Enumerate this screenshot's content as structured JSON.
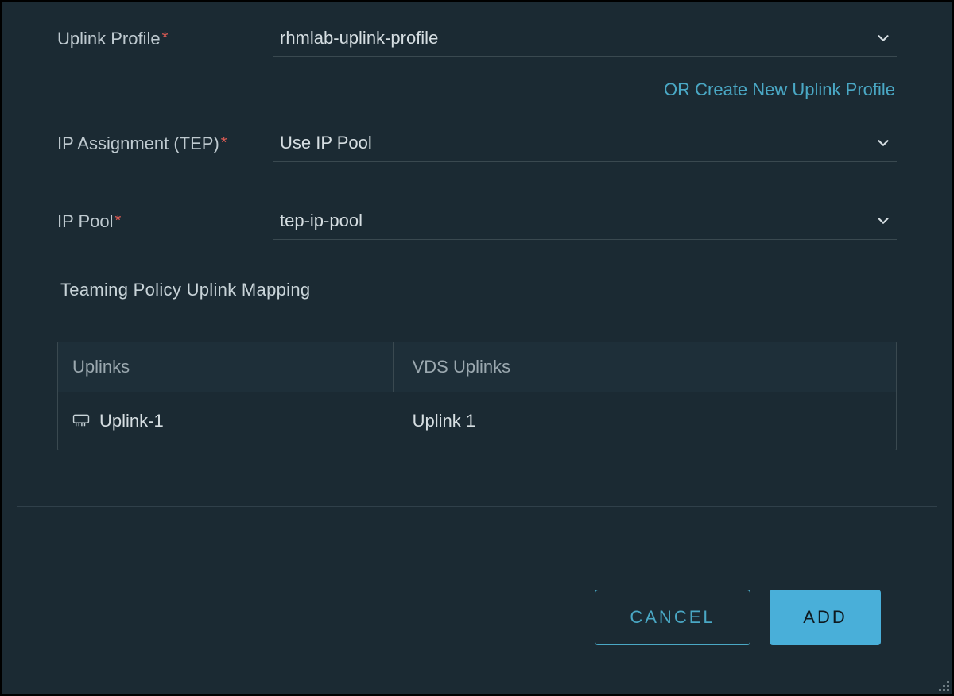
{
  "fields": {
    "uplink_profile": {
      "label": "Uplink Profile",
      "value": "rhmlab-uplink-profile",
      "create_link": "OR Create New Uplink Profile"
    },
    "ip_assignment": {
      "label": "IP Assignment (TEP)",
      "value": "Use IP Pool"
    },
    "ip_pool": {
      "label": "IP Pool",
      "value": "tep-ip-pool"
    }
  },
  "teaming": {
    "heading": "Teaming Policy Uplink Mapping",
    "columns": {
      "uplinks": "Uplinks",
      "vds": "VDS Uplinks"
    },
    "rows": [
      {
        "uplink": "Uplink-1",
        "vds": "Uplink 1"
      }
    ]
  },
  "buttons": {
    "cancel": "CANCEL",
    "add": "ADD"
  }
}
